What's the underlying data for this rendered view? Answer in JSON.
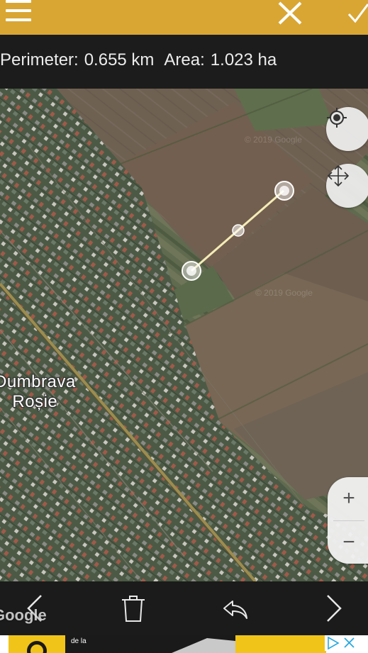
{
  "topbar": {
    "menu_icon": "hamburger-menu-icon",
    "close_icon": "close-icon",
    "confirm_icon": "check-icon",
    "accent_color": "#d9a633"
  },
  "measurement": {
    "perimeter_label": "Perimeter:",
    "perimeter_value": "0.655 km",
    "area_label": "Area:",
    "area_value": "1.023 ha"
  },
  "map": {
    "place_name_line1": "Dumbrava",
    "place_name_line2": "Roșie",
    "watermark": "Google",
    "tile_watermark_1": "© 2019 Google",
    "tile_watermark_2": "© 2019 Google",
    "controls": {
      "locate_icon": "my-location-icon",
      "pan_icon": "move-arrows-icon",
      "zoom_in_label": "+",
      "zoom_out_label": "−"
    }
  },
  "bottombar": {
    "prev_icon": "chevron-left-icon",
    "delete_icon": "trash-icon",
    "undo_icon": "undo-icon",
    "next_icon": "chevron-right-icon"
  },
  "ad": {
    "text_small": "de la",
    "choices_icon": "adchoices-icon",
    "close_icon": "ad-close-icon"
  }
}
